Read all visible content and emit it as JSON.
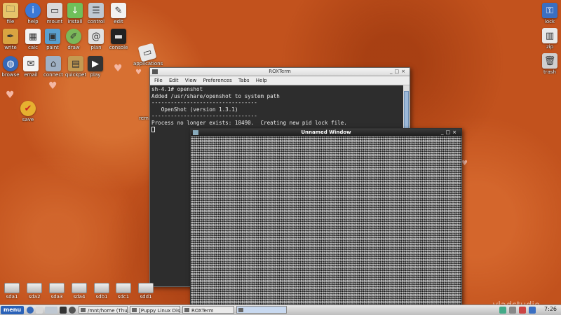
{
  "desktop": {
    "icons": [
      {
        "label": "file",
        "icon": "folder-icon",
        "color": "#e6c46a"
      },
      {
        "label": "help",
        "icon": "help-icon",
        "color": "#3a78d6"
      },
      {
        "label": "mount",
        "icon": "drive-icon",
        "color": "#d9d9d9"
      },
      {
        "label": "install",
        "icon": "install-icon",
        "color": "#6fbf5a"
      },
      {
        "label": "control",
        "icon": "control-icon",
        "color": "#bfc8d2"
      },
      {
        "label": "edit",
        "icon": "notepad-icon",
        "color": "#f2f2f2"
      },
      {
        "label": "write",
        "icon": "pen-icon",
        "color": "#d9a441"
      },
      {
        "label": "calc",
        "icon": "spreadsheet-icon",
        "color": "#f2f2f2"
      },
      {
        "label": "paint",
        "icon": "paint-icon",
        "color": "#5aa0d0"
      },
      {
        "label": "draw",
        "icon": "draw-icon",
        "color": "#7bb85a"
      },
      {
        "label": "plan",
        "icon": "plan-icon",
        "color": "#e0e0e0"
      },
      {
        "label": "console",
        "icon": "console-icon",
        "color": "#222222"
      },
      {
        "label": "browse",
        "icon": "globe-icon",
        "color": "#3468b8"
      },
      {
        "label": "email",
        "icon": "email-icon",
        "color": "#f4f4f4"
      },
      {
        "label": "connect",
        "icon": "network-icon",
        "color": "#9fb0c4"
      },
      {
        "label": "quickpet",
        "icon": "package-icon",
        "color": "#c49a52"
      },
      {
        "label": "play",
        "icon": "clapper-icon",
        "color": "#333333"
      },
      {
        "label": "save",
        "icon": "save-icon",
        "color": "#e6b030"
      },
      {
        "label": "applications",
        "icon": "applications-icon",
        "color": "#e8e8e8"
      },
      {
        "label": "lock",
        "icon": "lock-icon",
        "color": "#3a6fc2"
      },
      {
        "label": "zip",
        "icon": "zip-icon",
        "color": "#e8e8e8"
      },
      {
        "label": "trash",
        "icon": "trash-icon",
        "color": "#cfcfcf"
      }
    ],
    "partial_label": "rem",
    "drives": [
      "sda1",
      "sda2",
      "sda3",
      "sda4",
      "sdb1",
      "sdc1",
      "sdd1"
    ]
  },
  "terminal": {
    "title": "ROXTerm",
    "menu": [
      "File",
      "Edit",
      "View",
      "Preferences",
      "Tabs",
      "Help"
    ],
    "lines": [
      "sh-4.1# openshot",
      "Added /usr/share/openshot to system path",
      "---------------------------------",
      "   OpenShot (version 1.3.1)",
      "---------------------------------",
      "Process no longer exists: 18490.  Creating new pid lock file."
    ]
  },
  "unnamed_window": {
    "title": "Unnamed Window"
  },
  "taskbar": {
    "menu_label": "menu",
    "tasks": [
      "/mnt/home (Thu...",
      "[Puppy Linux Dis...",
      "ROXTerm",
      ""
    ],
    "time": "7:26"
  },
  "watermark": "vladstudio"
}
